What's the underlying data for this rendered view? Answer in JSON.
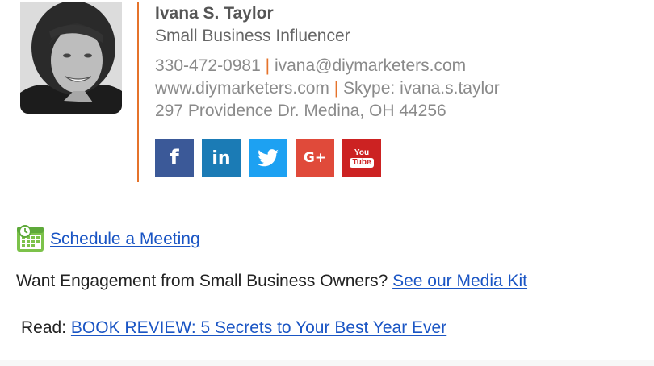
{
  "signature": {
    "name": "Ivana S. Taylor",
    "role": "Small Business Influencer",
    "phone": "330-472-0981",
    "separator": "|",
    "email": "ivana@diymarketers.com",
    "website": "www.diymarketers.com",
    "skype": "Skype: ivana.s.taylor",
    "address": "297 Providence Dr. Medina, OH 44256",
    "accent_color": "#e5732b"
  },
  "socials": [
    {
      "network": "facebook",
      "glyph": "f",
      "color": "#3b5998"
    },
    {
      "network": "linkedin",
      "glyph": "in",
      "color": "#1b7bb5"
    },
    {
      "network": "twitter",
      "glyph": "bird",
      "color": "#1da1f2"
    },
    {
      "network": "google-plus",
      "glyph": "G+",
      "color": "#e04a3a"
    },
    {
      "network": "youtube",
      "glyph": "You Tube",
      "color": "#cc2222"
    }
  ],
  "links": {
    "schedule_label": "Schedule a Meeting",
    "engagement_text": "Want Engagement from Small Business Owners?",
    "media_kit_label": "See our Media Kit",
    "read_prefix": "Read:",
    "book_review_label": "BOOK REVIEW: 5 Secrets to Your Best Year Ever",
    "link_color": "#1a55c4"
  },
  "icons": {
    "calendar": "calendar-icon",
    "photo": "avatar"
  }
}
